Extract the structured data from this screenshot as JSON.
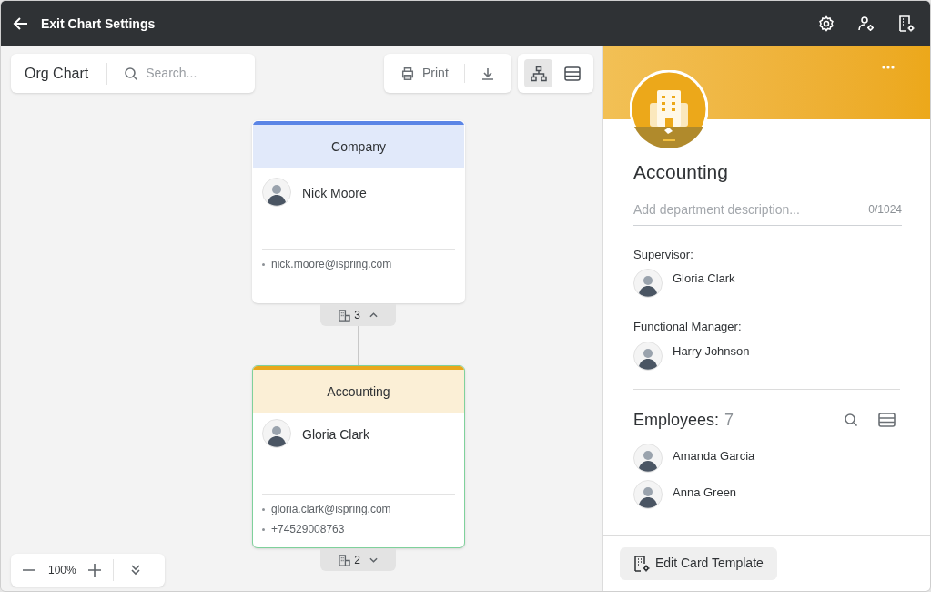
{
  "topbar": {
    "title": "Exit Chart Settings"
  },
  "toolbar": {
    "title": "Org Chart",
    "search": {
      "placeholder": "Search..."
    },
    "print": "Print",
    "views": [
      {
        "kind": "chart",
        "selected": true
      },
      {
        "kind": "list",
        "selected": false
      }
    ]
  },
  "nodes": [
    {
      "department": "Company",
      "color": "#5b85e6",
      "name": "Nick Moore",
      "contacts": [
        "nick.moore@ispring.com"
      ],
      "child_count": "3",
      "expanded": true,
      "selected": false
    },
    {
      "department": "Accounting",
      "color": "#e8a81c",
      "name": "Gloria Clark",
      "contacts": [
        "gloria.clark@ispring.com",
        "+74529008763"
      ],
      "child_count": "2",
      "expanded": false,
      "selected": true
    }
  ],
  "zoom": {
    "value": "100%"
  },
  "panel": {
    "department": "Accounting",
    "description": {
      "placeholder": "Add department description...",
      "counter": "0/1024"
    },
    "roles": [
      {
        "label": "Supervisor:",
        "name": "Gloria Clark"
      },
      {
        "label": "Functional Manager:",
        "name": "Harry Johnson"
      }
    ],
    "employees": {
      "label": "Employees:",
      "count": "7",
      "items": [
        "Amanda Garcia",
        "Anna Green"
      ]
    },
    "button": "Edit Card Template"
  }
}
